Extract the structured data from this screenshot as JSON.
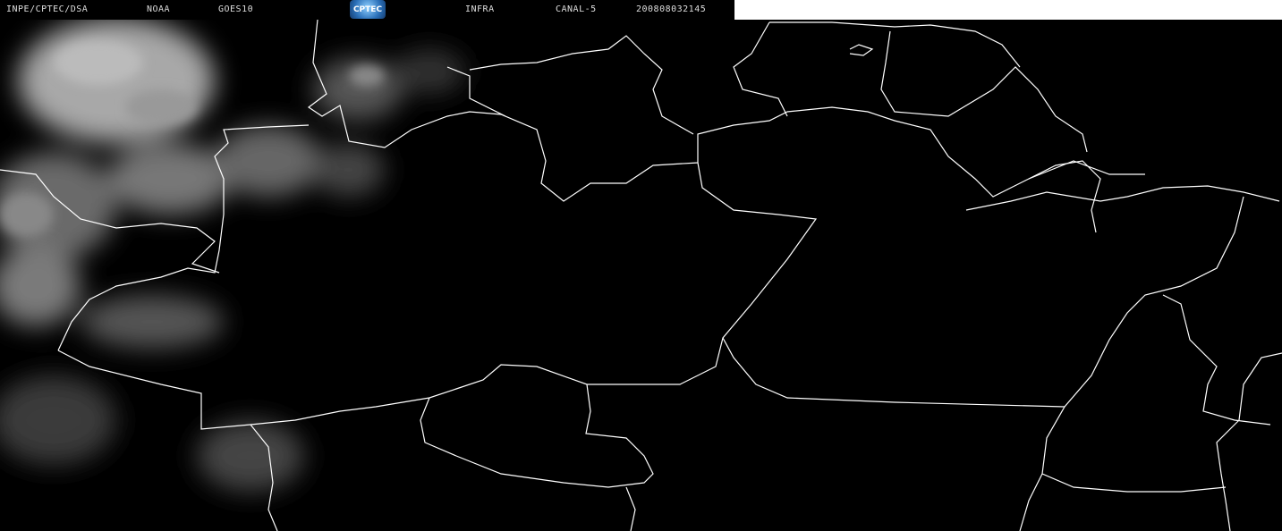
{
  "header": {
    "source": "INPE/CPTEC/DSA",
    "agency": "NOAA",
    "satellite": "GOES10",
    "logo_text": "CPTEC",
    "product": "INFRA",
    "channel": "CANAL-5",
    "datetime": "200808032145"
  },
  "colors": {
    "background": "#000000",
    "border_lines": "#ffffff",
    "clouds": "#9a9a9a"
  }
}
